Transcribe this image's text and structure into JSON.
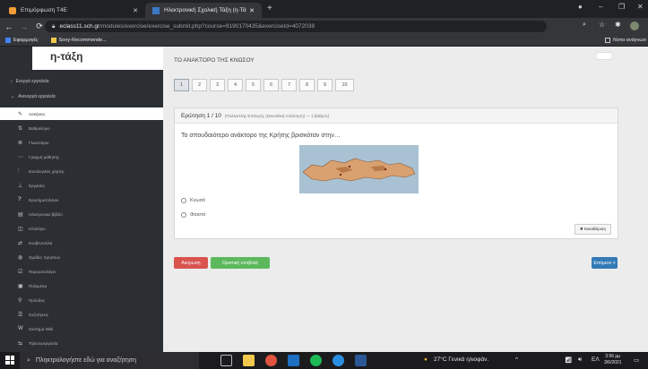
{
  "browser": {
    "tabs": [
      {
        "title": "Επιμόρφωση T4E",
        "active": false
      },
      {
        "title": "Ηλεκτρονική Σχολική Τάξη (η-Τά",
        "active": true
      }
    ],
    "url_host": "eclass11.sch.gr",
    "url_path": "/modules/exercise/exercise_submit.php?course=9190170435&exerciseId=4072038",
    "bookmarks": [
      "Εφαρμογές",
      "Sony-Recommende..."
    ],
    "reading_list": "Λίστα ανάγνωσ"
  },
  "sidebar": {
    "brand": "η-τάξη",
    "sections": [
      {
        "label": "Ενεργά εργαλεία",
        "expanded": false
      },
      {
        "label": "Ανενεργά εργαλεία",
        "expanded": true
      }
    ],
    "items": [
      {
        "label": "Ασκήσεις",
        "icon": "edit-icon"
      },
      {
        "label": "Βαθμολόγιο",
        "icon": "grades-icon"
      },
      {
        "label": "Γλωσσάριο",
        "icon": "glossary-icon"
      },
      {
        "label": "Γραμμή μάθησης",
        "icon": "path-icon"
      },
      {
        "label": "Ενεαλογικός χάρτης",
        "icon": "map-icon"
      },
      {
        "label": "Εργασίες",
        "icon": "tasks-icon"
      },
      {
        "label": "Ερωτηματολόγια",
        "icon": "question-icon"
      },
      {
        "label": "Ηλεκτρονικό βιβλίο",
        "icon": "book-icon"
      },
      {
        "label": "Ιστολόγιο",
        "icon": "blog-icon"
      },
      {
        "label": "Κουβεντούλα",
        "icon": "chat-icon"
      },
      {
        "label": "Ομάδες Χρηστών",
        "icon": "users-icon"
      },
      {
        "label": "Παρουσιολόγιο",
        "icon": "attendance-icon"
      },
      {
        "label": "Πολυμέσα",
        "icon": "media-icon"
      },
      {
        "label": "Πρόοδος",
        "icon": "progress-icon"
      },
      {
        "label": "Συζητήσεις",
        "icon": "forum-icon"
      },
      {
        "label": "Συστημα Wiki",
        "icon": "wiki-icon"
      },
      {
        "label": "Τηλεσυνεργασία",
        "icon": "conference-icon"
      }
    ]
  },
  "main": {
    "course_title": "ΤΟ ΑΝΑΚΤΟΡΟ ΤΗΣ ΚΝΩΣΟΥ",
    "pages": [
      "1",
      "2",
      "3",
      "4",
      "5",
      "6",
      "7",
      "8",
      "9",
      "10"
    ],
    "current_page": "1",
    "question_header": "Ερώτηση 1 / 10",
    "question_meta": "(Πολλαπλής Επιλογής (Μοναδική Απάντηση) — 1 βαθμός)",
    "question_text": "Το σπουδαιότερο ανάκτορο της Κρήτης βρισκόταν στην…",
    "options": [
      "Κνωσό",
      "Φαιστό"
    ],
    "clear_label": "✖ Εκκαθάριση",
    "cancel_label": "Ακύρωση",
    "submit_label": "Οριστική υποβολή",
    "next_label": "Επόμενο >"
  },
  "taskbar": {
    "search_placeholder": "Πληκτρολογήστε εδώ για αναζήτηση",
    "weather": "27°C Γενικά ηλιοφάν.",
    "lang": "ΕΛ",
    "time": "3:56 μμ",
    "date": "3/6/2021"
  },
  "colors": {
    "cancel": "#d9534f",
    "submit": "#5cb85c",
    "next": "#337ab7",
    "sidebar": "#2b2e33"
  }
}
